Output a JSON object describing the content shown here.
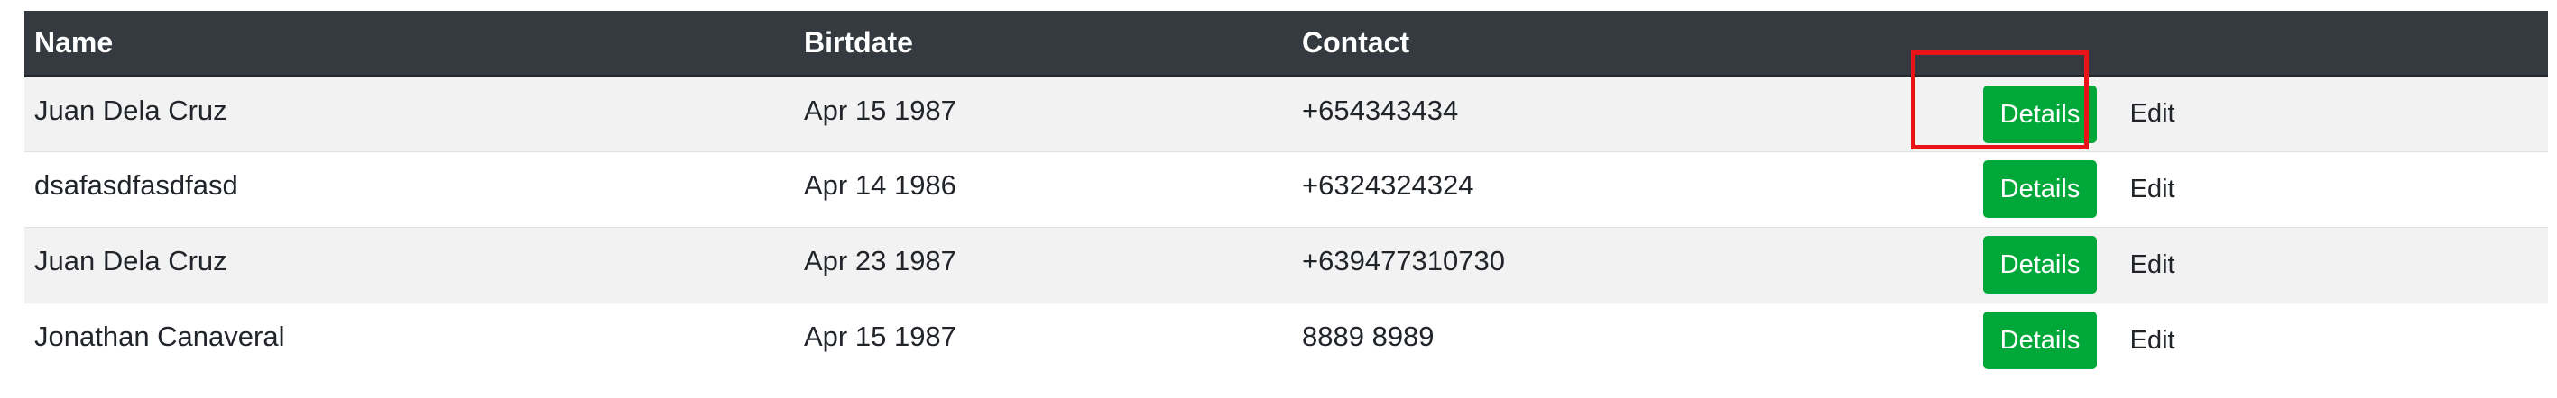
{
  "table": {
    "headers": {
      "name": "Name",
      "birthdate": "Birtdate",
      "contact": "Contact",
      "actions": ""
    },
    "rows": [
      {
        "name": "Juan Dela Cruz",
        "birthdate": "Apr 15 1987",
        "contact": "+654343434",
        "details_label": "Details",
        "edit_label": "Edit"
      },
      {
        "name": "dsafasdfasdfasd",
        "birthdate": "Apr 14 1986",
        "contact": "+6324324324",
        "details_label": "Details",
        "edit_label": "Edit"
      },
      {
        "name": "Juan Dela Cruz",
        "birthdate": "Apr 23 1987",
        "contact": "+639477310730",
        "details_label": "Details",
        "edit_label": "Edit"
      },
      {
        "name": "Jonathan Canaveral",
        "birthdate": "Apr 15 1987",
        "contact": "8889 8989",
        "details_label": "Details",
        "edit_label": "Edit"
      }
    ]
  },
  "colors": {
    "header_bg": "#343a40",
    "header_text": "#ffffff",
    "stripe_bg": "#f2f2f2",
    "details_button_bg": "#00a83a",
    "highlight_border": "#e8141a"
  },
  "highlight": {
    "target": "details-button",
    "row_index": 0
  }
}
